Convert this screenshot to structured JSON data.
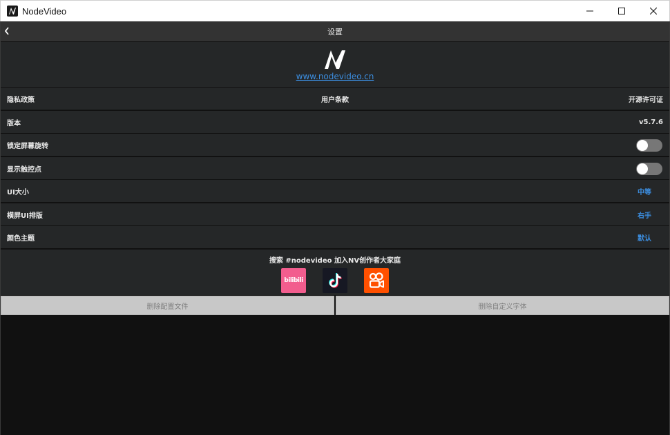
{
  "window": {
    "title": "NodeVideo",
    "icon": "nodevideo-logo-icon"
  },
  "topbar": {
    "title": "设置",
    "back_icon": "chevron-left-icon"
  },
  "header": {
    "link": "www.nodevideo.cn"
  },
  "legal": {
    "privacy": "隐私政策",
    "terms": "用户条款",
    "license": "开源许可证"
  },
  "settings": {
    "version_label": "版本",
    "version_value": "v5.7.6",
    "lock_rotation_label": "锁定屏幕旋转",
    "lock_rotation_on": false,
    "show_touches_label": "显示触控点",
    "show_touches_on": false,
    "ui_size_label": "UI大小",
    "ui_size_value": "中等",
    "landscape_layout_label": "横屏UI排版",
    "landscape_layout_value": "右手",
    "theme_label": "颜色主题",
    "theme_value": "默认"
  },
  "social": {
    "prompt": "搜索 #nodevideo 加入NV创作者大家庭",
    "items": [
      "bilibili-icon",
      "tiktok-icon",
      "kuaishou-icon"
    ],
    "bilibili_text": "bilibili"
  },
  "actions": {
    "delete_config": "删除配置文件",
    "delete_fonts": "删除自定义字体"
  },
  "colors": {
    "accent": "#3c8ee0",
    "panel": "#252728",
    "topbar": "#333333",
    "background": "#111111",
    "bilibili": "#f25d8e",
    "tiktok": "#161823",
    "kuaishou": "#ff5000"
  }
}
